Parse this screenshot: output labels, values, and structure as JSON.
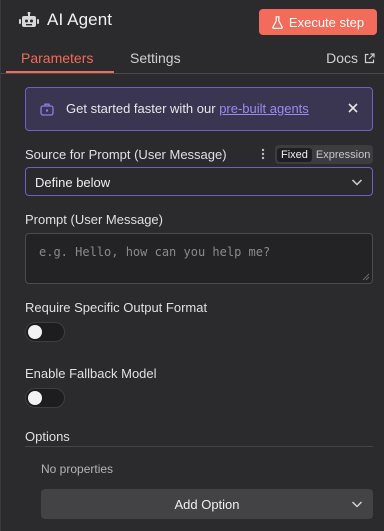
{
  "header": {
    "title": "AI Agent",
    "execute_label": "Execute step",
    "icons": {
      "node": "robot-icon",
      "execute": "flask-icon"
    }
  },
  "tabs": [
    {
      "label": "Parameters",
      "active": true
    },
    {
      "label": "Settings",
      "active": false
    }
  ],
  "docs": {
    "label": "Docs",
    "icon": "external-link-icon"
  },
  "banner": {
    "text": "Get started faster with our ",
    "link": "pre-built agents",
    "icon": "agent-box-icon",
    "close_icon": "close-icon"
  },
  "source_field": {
    "label": "Source for Prompt (User Message)",
    "mode_options": [
      "Fixed",
      "Expression"
    ],
    "mode_selected": "Fixed",
    "value": "Define below"
  },
  "prompt_field": {
    "label": "Prompt (User Message)",
    "placeholder": "e.g. Hello, how can you help me?"
  },
  "output_format": {
    "label": "Require Specific Output Format",
    "enabled": false
  },
  "fallback_model": {
    "label": "Enable Fallback Model",
    "enabled": false
  },
  "options": {
    "title": "Options",
    "empty_text": "No properties",
    "add_label": "Add Option"
  },
  "colors": {
    "accent": "#f26b5b",
    "focus": "#6f60c8",
    "link": "#9b8cf2",
    "background": "#2b2b2d"
  }
}
